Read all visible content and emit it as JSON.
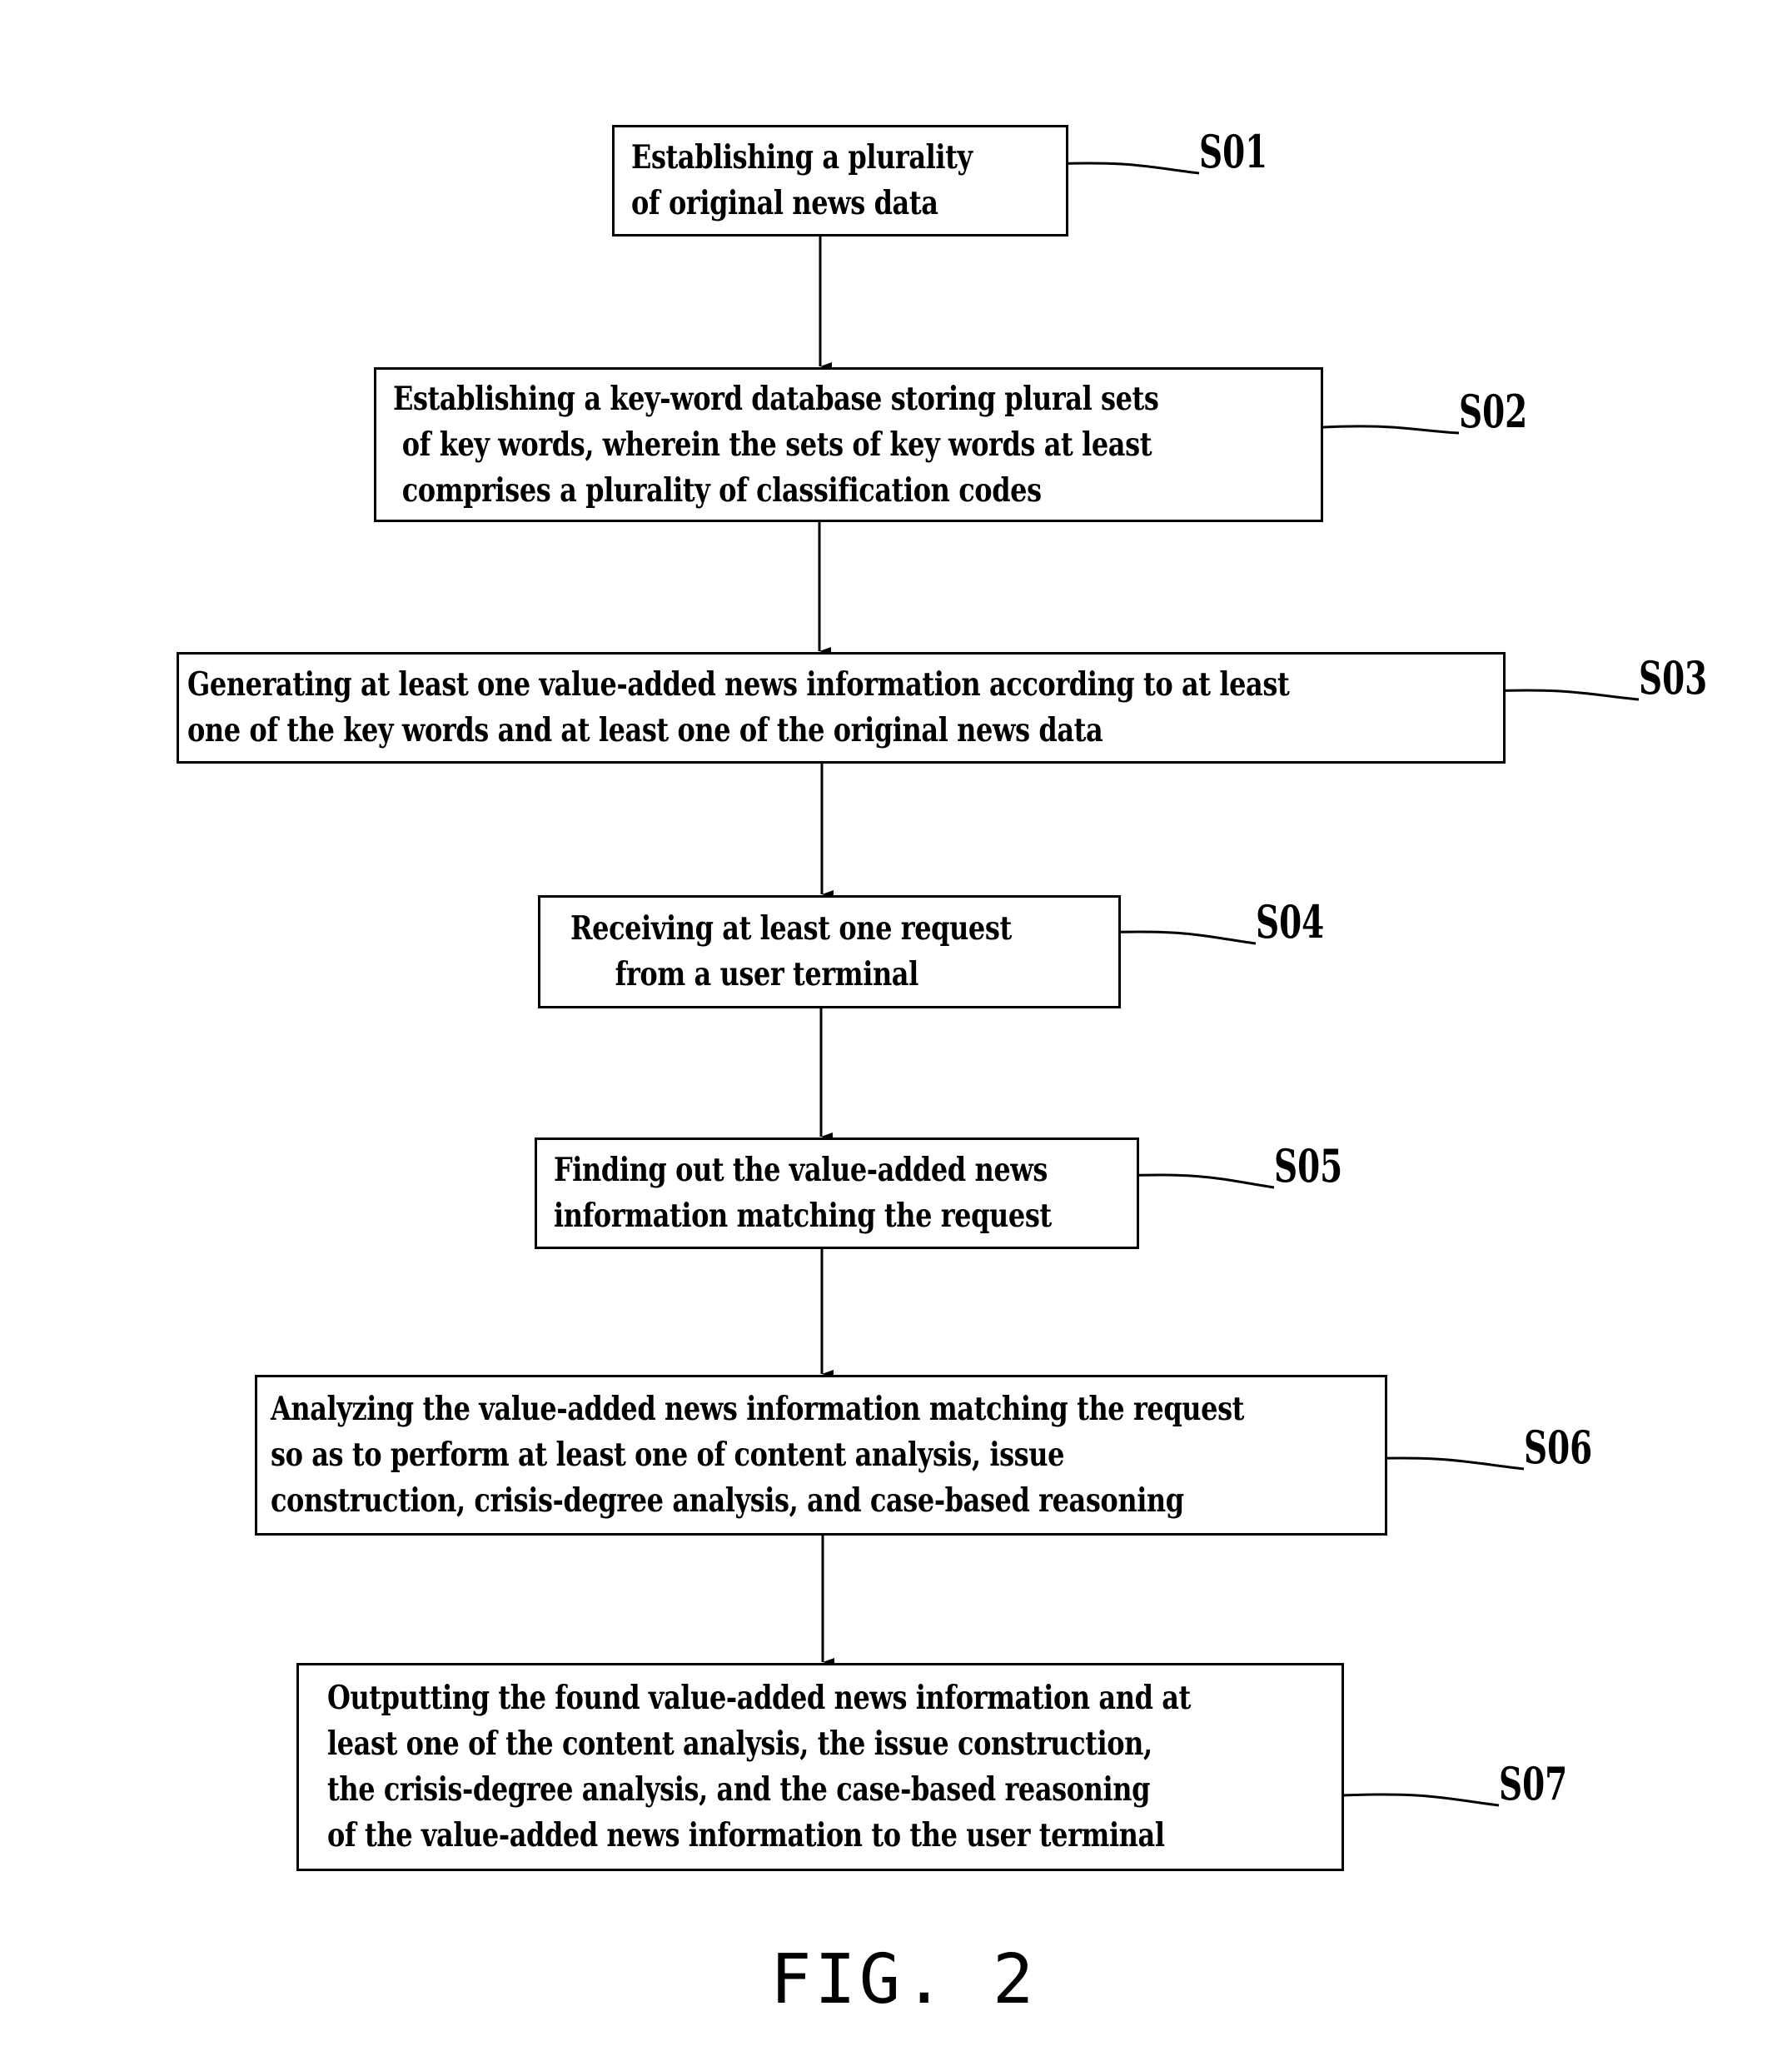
{
  "figure_caption": "FIG. 2",
  "steps": [
    {
      "id": "S01",
      "lines": [
        "Establishing a plurality",
        "of original news data"
      ]
    },
    {
      "id": "S02",
      "lines": [
        "Establishing a key-word database storing plural sets",
        " of key words, wherein the sets of key words at least",
        " comprises a plurality of classification codes"
      ]
    },
    {
      "id": "S03",
      "lines": [
        "Generating at least one value-added news information according to at least",
        "one of the key words and at least one of the original news data"
      ]
    },
    {
      "id": "S04",
      "lines": [
        "Receiving at least one request",
        "     from a user terminal"
      ]
    },
    {
      "id": "S05",
      "lines": [
        "Finding out the value-added news",
        "information matching the request"
      ]
    },
    {
      "id": "S06",
      "lines": [
        "Analyzing the value-added news information matching the request",
        "so as to perform at least one of content analysis, issue",
        "construction, crisis-degree analysis, and case-based reasoning"
      ]
    },
    {
      "id": "S07",
      "lines": [
        "Outputting the found value-added news information and at",
        "least one of the content analysis, the issue construction,",
        "the crisis-degree analysis, and the case-based reasoning",
        "of the value-added news information to the user terminal"
      ]
    }
  ]
}
